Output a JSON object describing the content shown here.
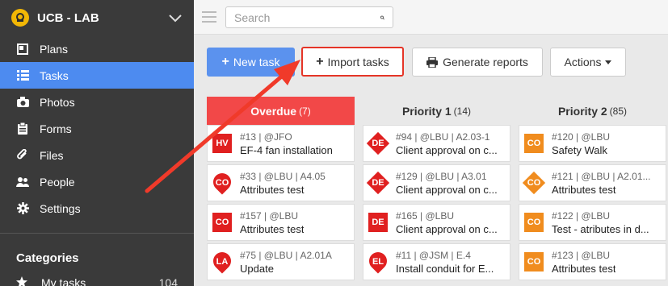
{
  "brand": {
    "name": "UCB - LAB",
    "logo_icon": "ucb-logo-icon"
  },
  "sidebar": {
    "items": [
      {
        "label": "Plans",
        "icon": "plans-icon"
      },
      {
        "label": "Tasks",
        "icon": "list-icon",
        "active": true
      },
      {
        "label": "Photos",
        "icon": "camera-icon"
      },
      {
        "label": "Forms",
        "icon": "clipboard-icon"
      },
      {
        "label": "Files",
        "icon": "paperclip-icon"
      },
      {
        "label": "People",
        "icon": "people-icon"
      },
      {
        "label": "Settings",
        "icon": "gear-icon"
      }
    ],
    "categories_heading": "Categories",
    "categories": [
      {
        "label": "My tasks",
        "count": "104",
        "icon": "star-icon"
      }
    ]
  },
  "search": {
    "placeholder": "Search"
  },
  "toolbar": {
    "new_task": "New task",
    "import_tasks": "Import tasks",
    "generate_reports": "Generate reports",
    "actions": "Actions"
  },
  "columns": [
    {
      "name": "Overdue",
      "count": "(7)",
      "cards": [
        {
          "badge": "HV",
          "shape": "square",
          "color": "#e02020",
          "meta": "#13 | @JFO",
          "title": "EF-4 fan installation"
        },
        {
          "badge": "CO",
          "shape": "pin",
          "color": "#e02020",
          "meta": "#33 | @LBU | A4.05",
          "title": "Attributes test"
        },
        {
          "badge": "CO",
          "shape": "square",
          "color": "#e02020",
          "meta": "#157 | @LBU",
          "title": "Attributes test"
        },
        {
          "badge": "LA",
          "shape": "pin",
          "color": "#e02020",
          "meta": "#75 | @LBU | A2.01A",
          "title": "Update"
        }
      ]
    },
    {
      "name": "Priority 1",
      "count": "(14)",
      "cards": [
        {
          "badge": "DE",
          "shape": "diamond",
          "color": "#e02020",
          "meta": "#94 | @LBU | A2.03-1",
          "title": "Client approval on c..."
        },
        {
          "badge": "DE",
          "shape": "diamond",
          "color": "#e02020",
          "meta": "#129 | @LBU | A3.01",
          "title": "Client approval on c..."
        },
        {
          "badge": "DE",
          "shape": "square",
          "color": "#e02020",
          "meta": "#165 | @LBU",
          "title": "Client approval on c..."
        },
        {
          "badge": "EL",
          "shape": "pin",
          "color": "#e02020",
          "meta": "#11 | @JSM | E.4",
          "title": "Install conduit for E..."
        }
      ]
    },
    {
      "name": "Priority 2",
      "count": "(85)",
      "cards": [
        {
          "badge": "CO",
          "shape": "square",
          "color": "#f08c1e",
          "meta": "#120 | @LBU",
          "title": "Safety Walk"
        },
        {
          "badge": "CO",
          "shape": "diamond",
          "color": "#f08c1e",
          "meta": "#121 | @LBU | A2.01...",
          "title": "Attributes test"
        },
        {
          "badge": "CO",
          "shape": "square",
          "color": "#f08c1e",
          "meta": "#122 | @LBU",
          "title": "Test - atributes in d..."
        },
        {
          "badge": "CO",
          "shape": "square",
          "color": "#f08c1e",
          "meta": "#123 | @LBU",
          "title": "Attributes test"
        }
      ]
    }
  ],
  "colors": {
    "accent": "#4d8bf0",
    "overdue": "#f24848",
    "highlight": "#e53527"
  }
}
